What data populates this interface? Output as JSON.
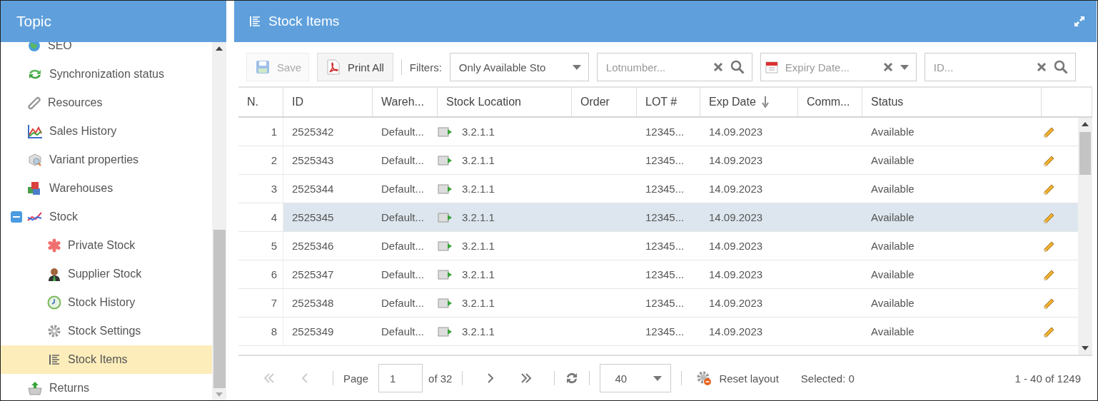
{
  "sidebar": {
    "title": "Topic",
    "items": [
      {
        "label": "SEO"
      },
      {
        "label": "Synchronization status"
      },
      {
        "label": "Resources"
      },
      {
        "label": "Sales History"
      },
      {
        "label": "Variant properties"
      },
      {
        "label": "Warehouses"
      },
      {
        "label": "Stock",
        "expanded": true,
        "children": [
          {
            "label": "Private Stock",
            "selected": false
          },
          {
            "label": "Supplier Stock",
            "selected": false
          },
          {
            "label": "Stock History",
            "selected": false
          },
          {
            "label": "Stock Settings",
            "selected": false
          },
          {
            "label": "Stock Items",
            "selected": true
          }
        ]
      },
      {
        "label": "Returns"
      }
    ]
  },
  "panel": {
    "title": "Stock Items"
  },
  "toolbar": {
    "save": {
      "label": "Save",
      "disabled": true
    },
    "print": {
      "label": "Print All",
      "disabled": false
    },
    "filters_label": "Filters:",
    "status_filter": {
      "value": "Only Available Sto"
    },
    "lot_filter": {
      "placeholder": "Lotnumber..."
    },
    "expiry_filter": {
      "placeholder": "Expiry Date..."
    },
    "id_filter": {
      "placeholder": "ID..."
    }
  },
  "table": {
    "columns": [
      {
        "label": "N.",
        "sorted": false
      },
      {
        "label": "ID",
        "sorted": false
      },
      {
        "label": "Wareh...",
        "sorted": false
      },
      {
        "label": "Stock Location",
        "sorted": false
      },
      {
        "label": "Order",
        "sorted": false
      },
      {
        "label": "LOT #",
        "sorted": false
      },
      {
        "label": "Exp Date",
        "sorted": true
      },
      {
        "label": "Comm...",
        "sorted": false
      },
      {
        "label": "Status",
        "sorted": false
      }
    ],
    "rows": [
      {
        "n": "1",
        "id": "2525342",
        "warehouse": "Default...",
        "location": "3.2.1.1",
        "lot": "12345...",
        "exp_date": "14.09.2023",
        "status": "Available",
        "selected": false
      },
      {
        "n": "2",
        "id": "2525343",
        "warehouse": "Default...",
        "location": "3.2.1.1",
        "lot": "12345...",
        "exp_date": "14.09.2023",
        "status": "Available",
        "selected": false
      },
      {
        "n": "3",
        "id": "2525344",
        "warehouse": "Default...",
        "location": "3.2.1.1",
        "lot": "12345...",
        "exp_date": "14.09.2023",
        "status": "Available",
        "selected": false
      },
      {
        "n": "4",
        "id": "2525345",
        "warehouse": "Default...",
        "location": "3.2.1.1",
        "lot": "12345...",
        "exp_date": "14.09.2023",
        "status": "Available",
        "selected": true
      },
      {
        "n": "5",
        "id": "2525346",
        "warehouse": "Default...",
        "location": "3.2.1.1",
        "lot": "12345...",
        "exp_date": "14.09.2023",
        "status": "Available",
        "selected": false
      },
      {
        "n": "6",
        "id": "2525347",
        "warehouse": "Default...",
        "location": "3.2.1.1",
        "lot": "12345...",
        "exp_date": "14.09.2023",
        "status": "Available",
        "selected": false
      },
      {
        "n": "7",
        "id": "2525348",
        "warehouse": "Default...",
        "location": "3.2.1.1",
        "lot": "12345...",
        "exp_date": "14.09.2023",
        "status": "Available",
        "selected": false
      },
      {
        "n": "8",
        "id": "2525349",
        "warehouse": "Default...",
        "location": "3.2.1.1",
        "lot": "12345...",
        "exp_date": "14.09.2023",
        "status": "Available",
        "selected": false
      }
    ]
  },
  "pager": {
    "first": {
      "disabled": true
    },
    "prev": {
      "disabled": true
    },
    "next": {
      "disabled": false
    },
    "last": {
      "disabled": false
    },
    "page_label": "Page",
    "page": "1",
    "of_pages": "of 32",
    "page_size": "40",
    "reset_label": "Reset layout",
    "selected_count": "Selected: 0",
    "range": "1 - 40 of 1249"
  }
}
